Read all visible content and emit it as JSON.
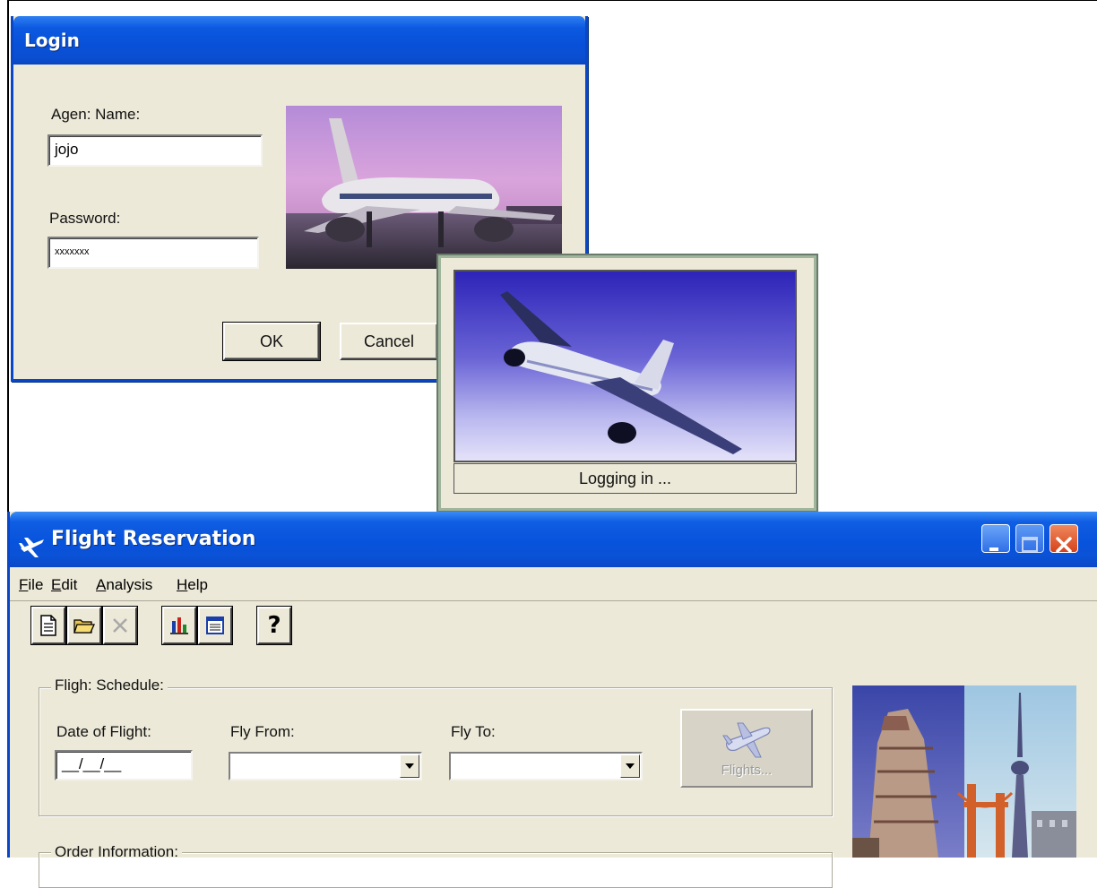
{
  "login": {
    "title": "Login",
    "agent_label": "Agen: Name:",
    "agent_value": "jojo",
    "password_label": "Password:",
    "password_value": "xxxxxxx",
    "ok_label": "OK",
    "cancel_label": "Cancel"
  },
  "splash": {
    "status": "Logging in ..."
  },
  "flight_window": {
    "title": "Flight Reservation",
    "menu": [
      {
        "label": "File",
        "accel": "F",
        "rest": "ile"
      },
      {
        "label": "Edit",
        "accel": "E",
        "rest": "dit"
      },
      {
        "label": "Analysis",
        "accel": "A",
        "rest": "nalysis"
      },
      {
        "label": "Help",
        "accel": "H",
        "rest": "elp"
      }
    ],
    "toolbar": {
      "help_glyph": "?"
    },
    "schedule": {
      "legend": "Fligh: Schedule:",
      "date_label": "Date of Flight:",
      "date_value": "__/__/__",
      "from_label": "Fly From:",
      "from_value": "",
      "to_label": "Fly To:",
      "to_value": "",
      "flights_label": "Flights..."
    },
    "order": {
      "legend": "Order Information:"
    }
  },
  "colors": {
    "xp_blue": "#0a4fd2",
    "window_face": "#ece9d8",
    "close_red": "#d5431b"
  },
  "icons": [
    "new-order-icon",
    "open-order-icon",
    "delete-order-icon",
    "graph-icon",
    "report-icon",
    "help-icon",
    "airplane-icon"
  ]
}
